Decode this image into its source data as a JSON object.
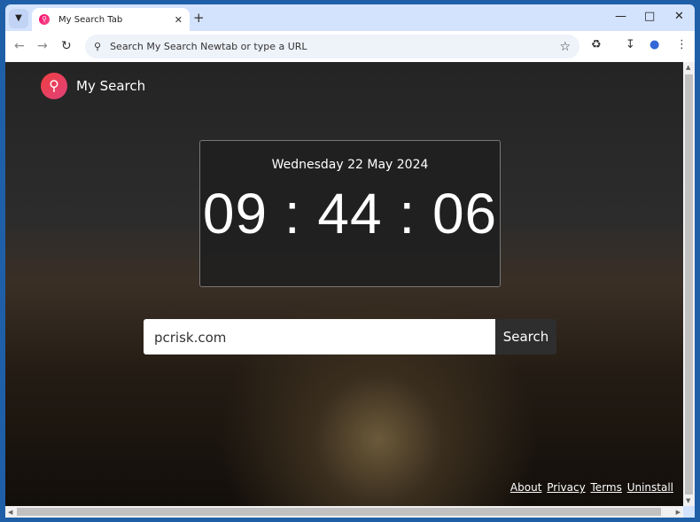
{
  "browser": {
    "tab_title": "My Search Tab",
    "omnibox_placeholder": "Search My Search Newtab or type a URL"
  },
  "page": {
    "brand": "My Search",
    "date": "Wednesday 22 May 2024",
    "time": "09 : 44 : 06",
    "search_value": "pcrisk.com",
    "search_button": "Search",
    "footer_links": [
      "About",
      "Privacy",
      "Terms",
      "Uninstall"
    ]
  }
}
